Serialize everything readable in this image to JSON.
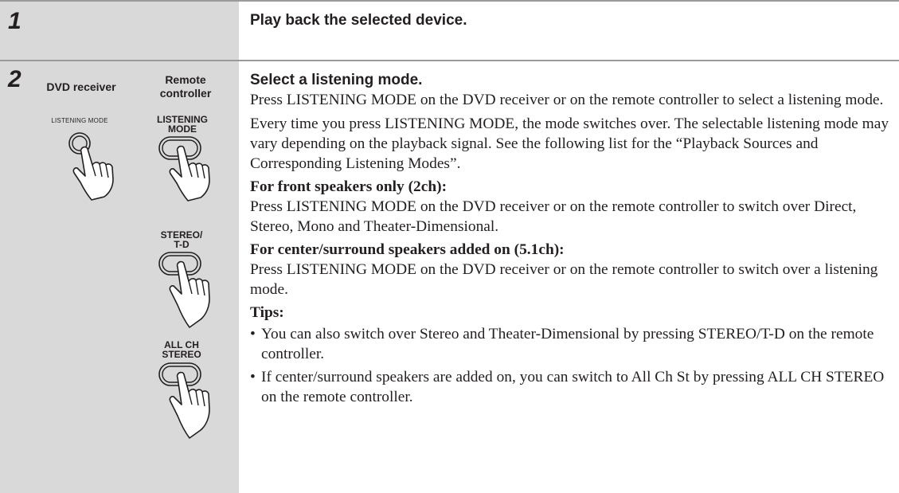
{
  "step1": {
    "number": "1",
    "heading": "Play back the selected device."
  },
  "step2": {
    "number": "2",
    "col_dvd_receiver": "DVD receiver",
    "col_remote_controller_line1": "Remote",
    "col_remote_controller_line2": "controller",
    "receiver_button_label": "LISTENING MODE",
    "remote_buttons": [
      {
        "line1": "LISTENING",
        "line2": "MODE"
      },
      {
        "line1": "STEREO/",
        "line2": "T-D"
      },
      {
        "line1": "ALL CH",
        "line2": "STEREO"
      }
    ],
    "heading": "Select a listening mode.",
    "para1": "Press LISTENING MODE on the DVD receiver or on the remote controller to select a listening mode.",
    "para2": "Every time you press LISTENING MODE, the mode switches over. The selectable listening mode may vary depending on the playback signal. See the following list for the “Playback Sources and Corresponding Listening Modes”.",
    "front_heading": "For front speakers only (2ch):",
    "front_text": "Press LISTENING MODE on the DVD receiver or on the remote controller to switch over Direct, Stereo, Mono and Theater-Dimensional.",
    "center_heading": "For center/surround speakers added on (5.1ch):",
    "center_text": "Press LISTENING MODE on the DVD receiver or on the remote controller to switch over a listening mode.",
    "tips_heading": "Tips:",
    "tips": [
      "You can also switch over Stereo and Theater-Dimensional by pressing STEREO/T-D on the remote controller.",
      "If center/surround speakers are added on, you can switch to All Ch St by pressing ALL CH STEREO on the remote controller."
    ]
  }
}
